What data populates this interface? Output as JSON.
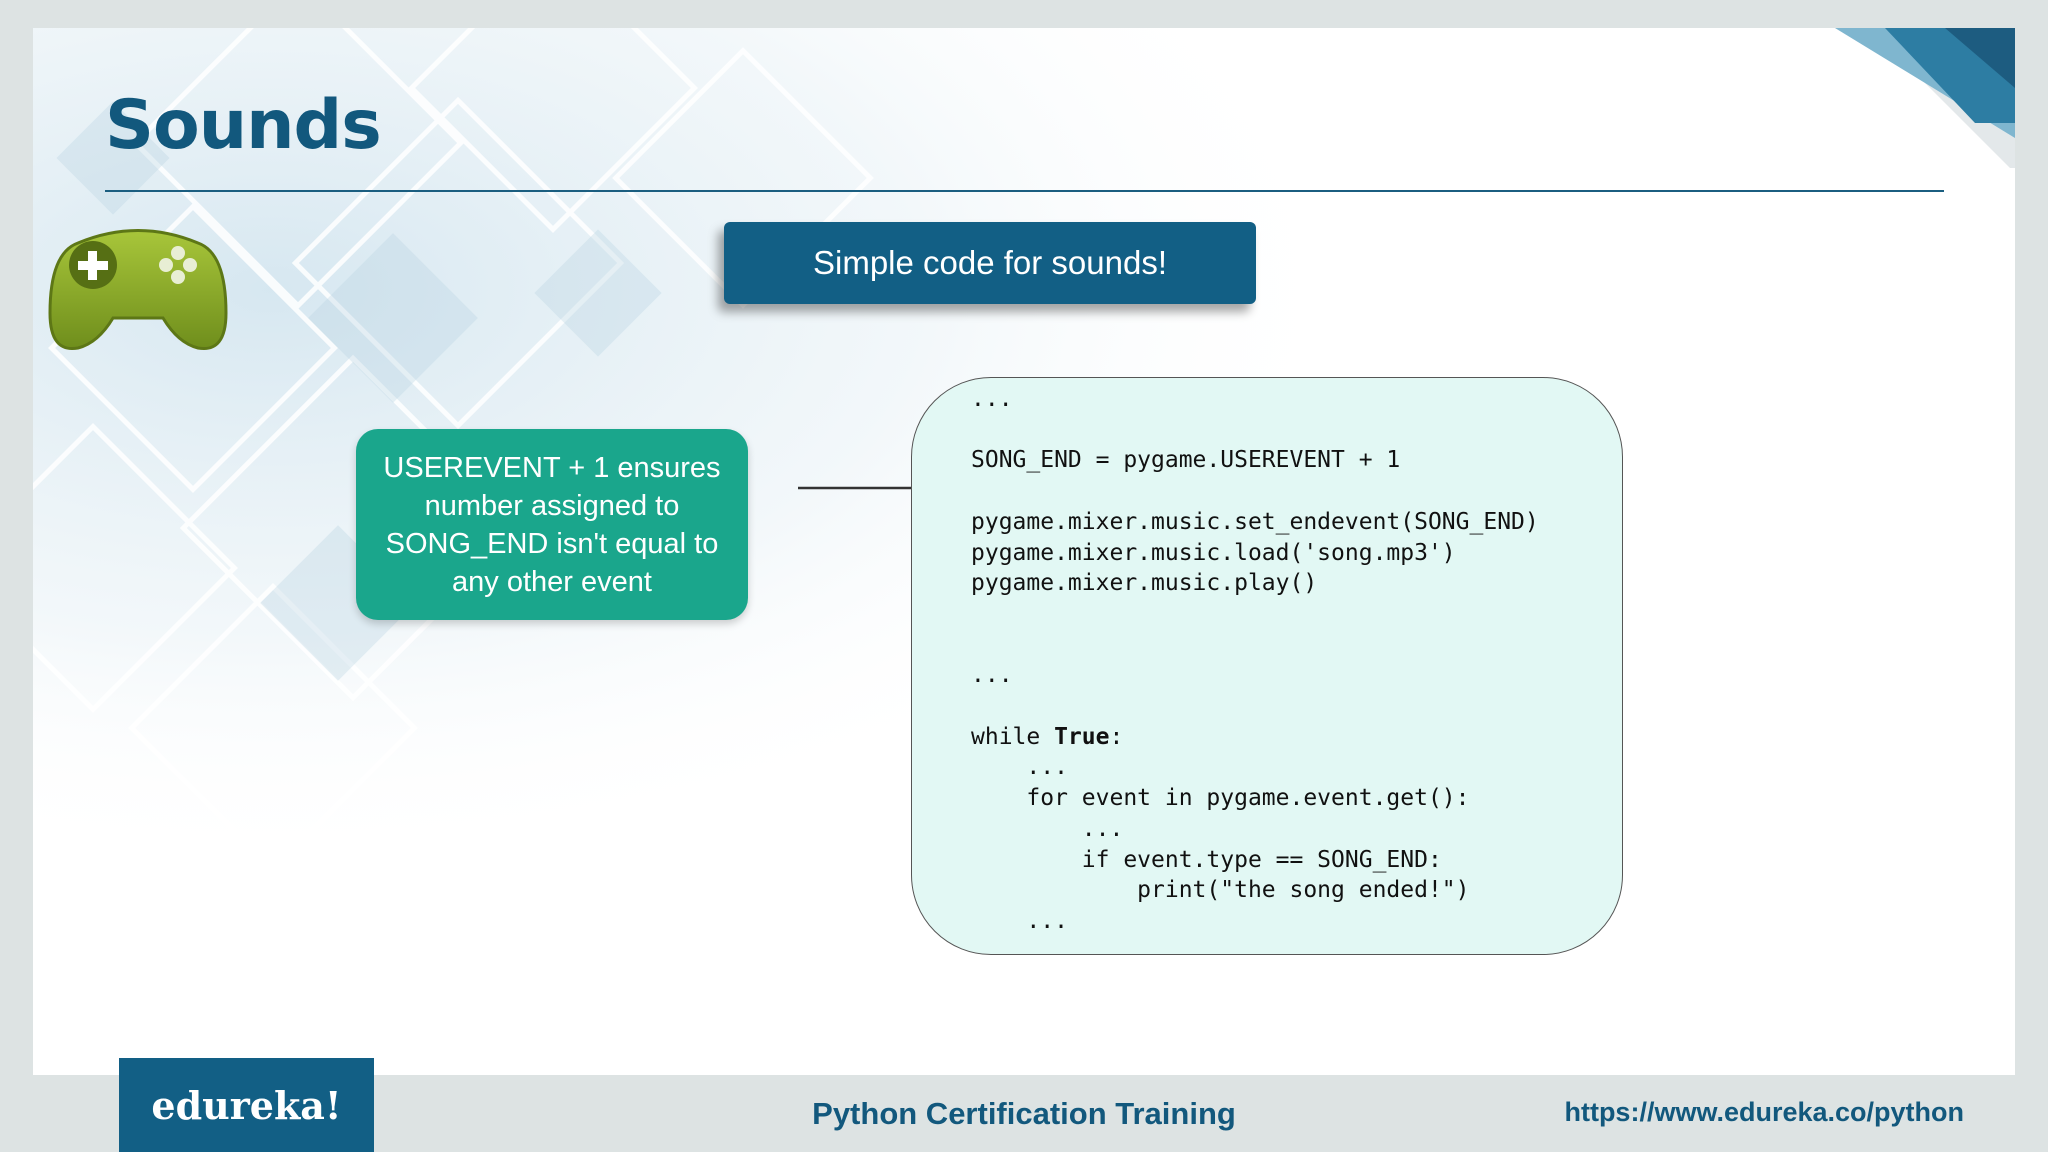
{
  "slide": {
    "title": "Sounds",
    "banner_text": "Simple code for sounds!",
    "callout_text": "USEREVENT + 1 ensures\nnumber assigned to\nSONG_END isn't equal to\nany other event",
    "icons": [
      "gamepad-icon",
      "arrow-right-icon"
    ],
    "code_lines": [
      "...",
      "",
      "SONG_END = pygame.USEREVENT + 1",
      "",
      "pygame.mixer.music.set_endevent(SONG_END)",
      "pygame.mixer.music.load('song.mp3')",
      "pygame.mixer.music.play()",
      "",
      "",
      "...",
      "",
      "while True:",
      "    ...",
      "    for event in pygame.event.get():",
      "        ...",
      "        if event.type == SONG_END:",
      "            print(\"the song ended!\")",
      "    ..."
    ]
  },
  "footer": {
    "logo": "edureka!",
    "course": "Python Certification Training",
    "url": "https://www.edureka.co/python"
  },
  "colors": {
    "brand_blue": "#125f85",
    "teal": "#1aa68c",
    "code_bg": "#e2f8f4",
    "page_bg": "#dde3e3"
  }
}
